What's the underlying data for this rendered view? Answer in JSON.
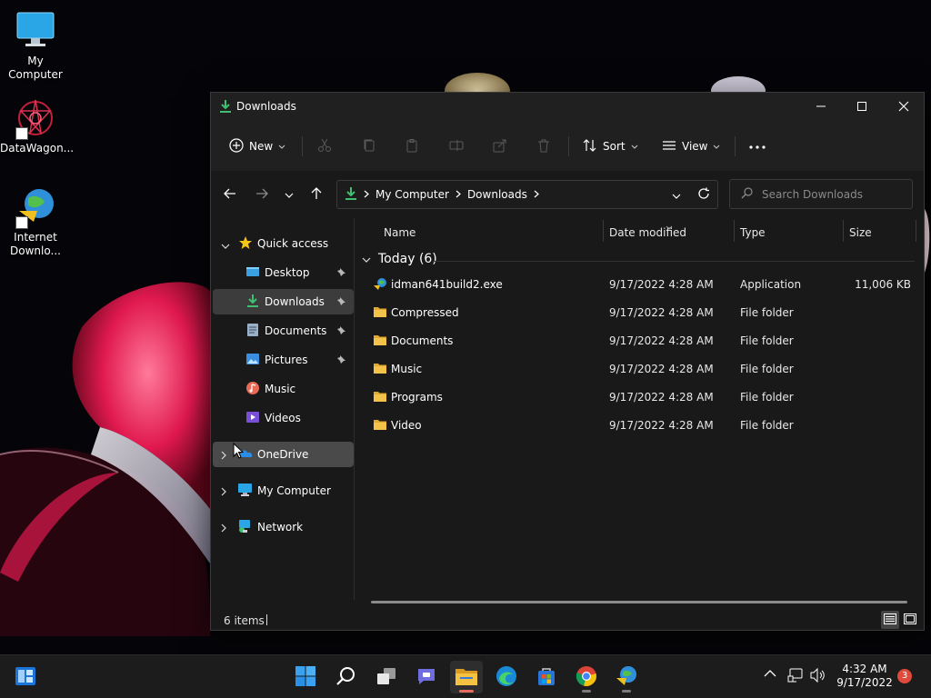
{
  "desktop": {
    "icons": [
      {
        "label": "My Computer",
        "icon": "monitor-icon"
      },
      {
        "label": "DataWagon...",
        "icon": "datawagon-icon"
      },
      {
        "label": "Internet Downlo...",
        "icon": "idm-globe-icon"
      }
    ]
  },
  "window": {
    "title": "Downloads",
    "commands": {
      "new_label": "New",
      "sort_label": "Sort",
      "view_label": "View"
    },
    "address": {
      "crumbs": [
        "My Computer",
        "Downloads"
      ]
    },
    "search": {
      "placeholder": "Search Downloads"
    },
    "nav": {
      "quick_access": "Quick access",
      "items": [
        {
          "label": "Desktop",
          "pinned": true
        },
        {
          "label": "Downloads",
          "pinned": true
        },
        {
          "label": "Documents",
          "pinned": true
        },
        {
          "label": "Pictures",
          "pinned": true
        },
        {
          "label": "Music",
          "pinned": false
        },
        {
          "label": "Videos",
          "pinned": false
        }
      ],
      "onedrive": "OneDrive",
      "my_computer": "My Computer",
      "network": "Network"
    },
    "columns": {
      "name": "Name",
      "date": "Date modified",
      "type": "Type",
      "size": "Size"
    },
    "group": {
      "label": "Today (6)"
    },
    "files": [
      {
        "name": "idman641build2.exe",
        "date": "9/17/2022 4:28 AM",
        "type": "Application",
        "size": "11,006 KB",
        "icon": "exe-icon"
      },
      {
        "name": "Compressed",
        "date": "9/17/2022 4:28 AM",
        "type": "File folder",
        "size": "",
        "icon": "folder-icon"
      },
      {
        "name": "Documents",
        "date": "9/17/2022 4:28 AM",
        "type": "File folder",
        "size": "",
        "icon": "folder-icon"
      },
      {
        "name": "Music",
        "date": "9/17/2022 4:28 AM",
        "type": "File folder",
        "size": "",
        "icon": "folder-icon"
      },
      {
        "name": "Programs",
        "date": "9/17/2022 4:28 AM",
        "type": "File folder",
        "size": "",
        "icon": "folder-icon"
      },
      {
        "name": "Video",
        "date": "9/17/2022 4:28 AM",
        "type": "File folder",
        "size": "",
        "icon": "folder-icon"
      }
    ],
    "status": {
      "items_count": "6 items"
    }
  },
  "taskbar": {
    "clock": {
      "time": "4:32 AM",
      "date": "9/17/2022"
    },
    "notification_count": "3",
    "apps": [
      "start",
      "search",
      "task-view",
      "teams-chat",
      "file-explorer",
      "edge",
      "store",
      "chrome",
      "idm"
    ]
  },
  "colors": {
    "accent": "#4cc2ff",
    "download_green": "#3fbf6f",
    "folder_yellow": "#f2c24a",
    "window_bg": "#191919",
    "selected_bg": "#3c3c3c"
  }
}
